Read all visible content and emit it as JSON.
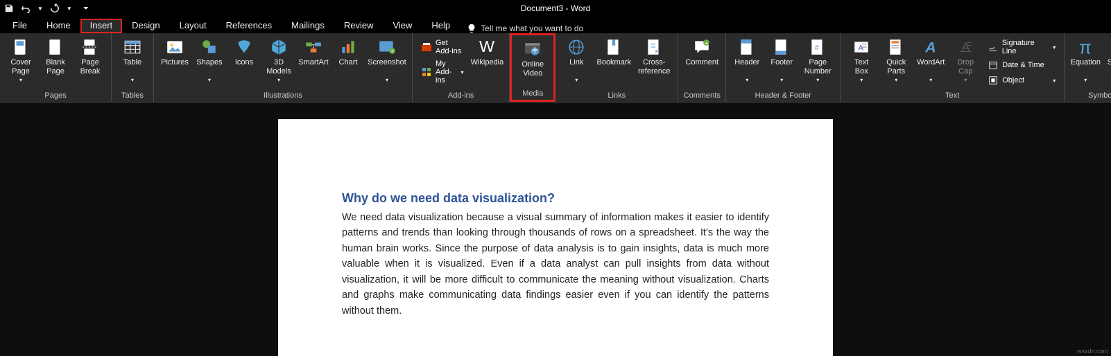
{
  "title": "Document3  -  Word",
  "tabs": {
    "file": "File",
    "home": "Home",
    "insert": "Insert",
    "design": "Design",
    "layout": "Layout",
    "references": "References",
    "mailings": "Mailings",
    "review": "Review",
    "view": "View",
    "help": "Help"
  },
  "tellme": "Tell me what you want to do",
  "groups": {
    "pages": {
      "label": "Pages",
      "cover": "Cover\nPage",
      "blank": "Blank\nPage",
      "break": "Page\nBreak"
    },
    "tables": {
      "label": "Tables",
      "table": "Table"
    },
    "illus": {
      "label": "Illustrations",
      "pictures": "Pictures",
      "shapes": "Shapes",
      "icons": "Icons",
      "models": "3D\nModels",
      "smartart": "SmartArt",
      "chart": "Chart",
      "screenshot": "Screenshot"
    },
    "addins": {
      "label": "Add-ins",
      "get": "Get Add-ins",
      "my": "My Add-ins",
      "wiki": "Wikipedia"
    },
    "media": {
      "label": "Media",
      "online": "Online\nVideo"
    },
    "links": {
      "label": "Links",
      "link": "Link",
      "bookmark": "Bookmark",
      "cross": "Cross-\nreference"
    },
    "comments": {
      "label": "Comments",
      "comment": "Comment"
    },
    "hf": {
      "label": "Header & Footer",
      "header": "Header",
      "footer": "Footer",
      "page": "Page\nNumber"
    },
    "text": {
      "label": "Text",
      "box": "Text\nBox",
      "quick": "Quick\nParts",
      "wordart": "WordArt",
      "drop": "Drop\nCap",
      "sig": "Signature Line",
      "date": "Date & Time",
      "obj": "Object"
    },
    "symbols": {
      "label": "Symbols",
      "eq": "Equation",
      "sym": "Symbol"
    }
  },
  "doc": {
    "heading": "Why do we need data visualization?",
    "body": "We need data visualization because a visual summary of information makes it easier to identify patterns and trends than looking through thousands of rows on a spreadsheet. It's the way the human brain works. Since the purpose of data analysis is to gain insights, data is much more valuable when it is visualized. Even if a data analyst can pull insights from data without visualization, it will be more difficult to communicate the meaning without visualization. Charts and graphs make communicating data findings easier even if you can identify the patterns without them."
  },
  "watermark": "wsxdn.com"
}
